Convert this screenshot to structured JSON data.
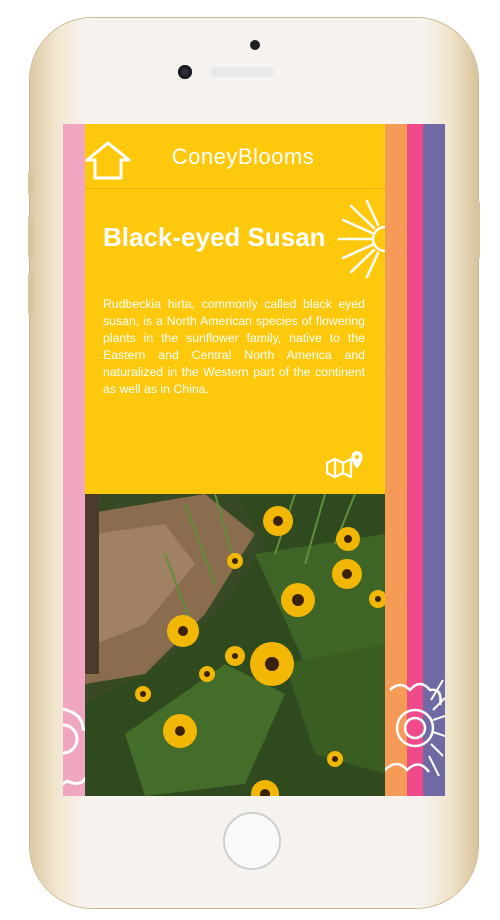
{
  "app": {
    "title": "ConeyBlooms"
  },
  "flower": {
    "name": "Black-eyed Susan",
    "description": "Rudbeckia hirta, commonly called black eyed susan, is a North American species of flowering plants in the sunflower family, native to the Eastern and Central North America and naturalized in the Western part of the continent as well as in China."
  },
  "icons": {
    "home": "home-icon",
    "flower": "sunflower-icon",
    "map": "map-pin-icon"
  },
  "colors": {
    "card": "#fec90d",
    "pink": "#f0a6c0",
    "orange": "#f69a57",
    "magenta": "#ef4b8a",
    "purple": "#6f6aa4"
  }
}
